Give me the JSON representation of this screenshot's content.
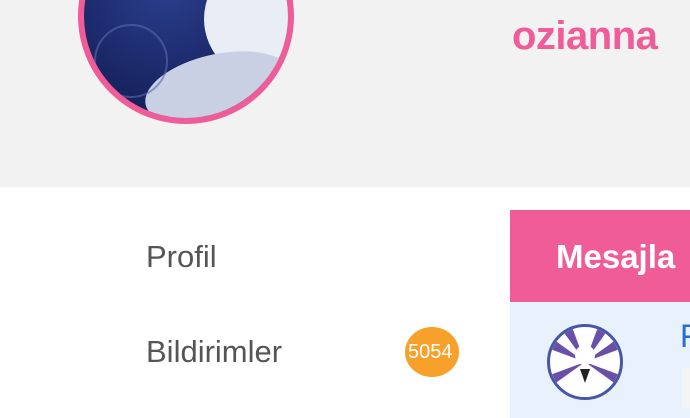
{
  "profile": {
    "username": "ozianna",
    "accent_color": "#ef5c97"
  },
  "sidebar": {
    "items": [
      {
        "label": "Profil"
      },
      {
        "label": "Bildirimler",
        "badge": "5054"
      }
    ],
    "badge_color": "#f7a12b"
  },
  "messages": {
    "title": "Mesajla",
    "first_sender_initial": "F",
    "row_bg": "#e9f2fc"
  }
}
